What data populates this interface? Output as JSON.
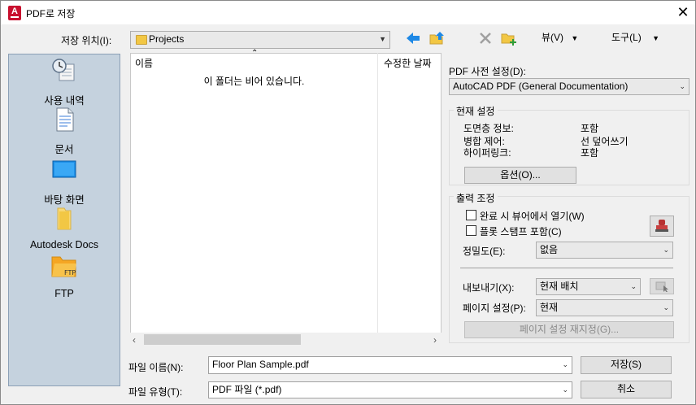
{
  "window": {
    "title": "PDF로 저장",
    "close_glyph": "✕"
  },
  "location": {
    "label": "저장 위치(I):",
    "value": "Projects",
    "toolbar": {
      "view_label": "뷰(V)",
      "tools_label": "도구(L)"
    }
  },
  "places": [
    {
      "label": "사용 내역",
      "icon": "history-icon"
    },
    {
      "label": "문서",
      "icon": "documents-icon"
    },
    {
      "label": "바탕 화면",
      "icon": "desktop-icon"
    },
    {
      "label": "Autodesk Docs",
      "icon": "autodesk-docs-icon"
    },
    {
      "label": "FTP",
      "icon": "ftp-icon",
      "icon_text": "FTP"
    }
  ],
  "file_list": {
    "col_name": "이름",
    "col_modified": "수정한 날짜",
    "empty_message": "이 폴더는 비어 있습니다."
  },
  "pdf_preset": {
    "label": "PDF 사전 설정(D):",
    "value": "AutoCAD PDF (General Documentation)"
  },
  "current_settings": {
    "title": "현재 설정",
    "rows": [
      {
        "key": "도면층 정보:",
        "value": "포함"
      },
      {
        "key": "병합 제어:",
        "value": "선 덮어쓰기"
      },
      {
        "key": "하이퍼링크:",
        "value": "포함"
      }
    ],
    "options_button": "옵션(O)..."
  },
  "output_control": {
    "title": "출력 조정",
    "open_in_viewer": {
      "label": "완료 시 뷰어에서 열기(W)",
      "checked": false
    },
    "include_plot_stamp": {
      "label": "플롯 스탬프 포함(C)",
      "checked": false
    },
    "precision": {
      "label": "정밀도(E):",
      "value": "없음"
    },
    "export": {
      "label": "내보내기(X):",
      "value": "현재 배치"
    },
    "page_setup": {
      "label": "페이지 설정(P):",
      "value": "현재"
    },
    "page_setup_override": "페이지 설정 재지정(G)..."
  },
  "filename": {
    "label": "파일 이름(N):",
    "value": "Floor Plan Sample.pdf"
  },
  "filetype": {
    "label": "파일 유형(T):",
    "value": "PDF 파일 (*.pdf)"
  },
  "buttons": {
    "save": "저장(S)",
    "cancel": "취소"
  },
  "colors": {
    "places_bg": "#c5d2de",
    "autodesk_red": "#c8102e",
    "arrow_blue": "#1e88e5",
    "folder_yellow": "#f2c744"
  }
}
